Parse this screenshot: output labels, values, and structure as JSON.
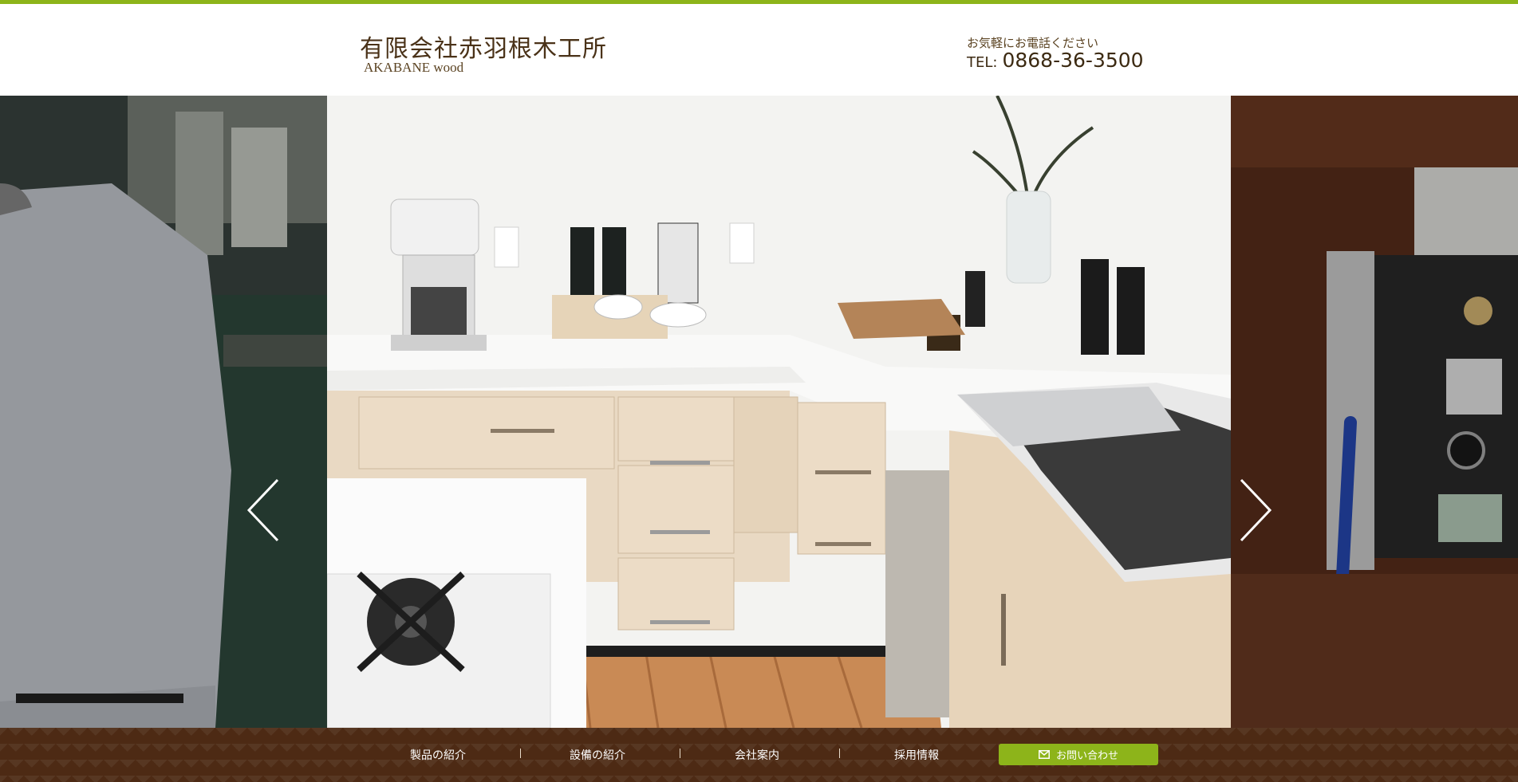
{
  "header": {
    "logo_jp": "有限会社赤羽根木工所",
    "logo_en": "AKABANE wood",
    "tel_note": "お気軽にお電話ください",
    "tel_label": "TEL:",
    "tel_number": "0868-36-3500"
  },
  "slider": {
    "prev_icon": "chevron-left-icon",
    "next_icon": "chevron-right-icon"
  },
  "nav": {
    "items": [
      {
        "label": "製品の紹介"
      },
      {
        "label": "設備の紹介"
      },
      {
        "label": "会社案内"
      },
      {
        "label": "採用情報"
      }
    ],
    "contact_label": "お問い合わせ",
    "contact_icon": "mail-icon"
  },
  "colors": {
    "accent": "#8db41a",
    "brown": "#4d2a14",
    "logo_text": "#4a3218"
  }
}
